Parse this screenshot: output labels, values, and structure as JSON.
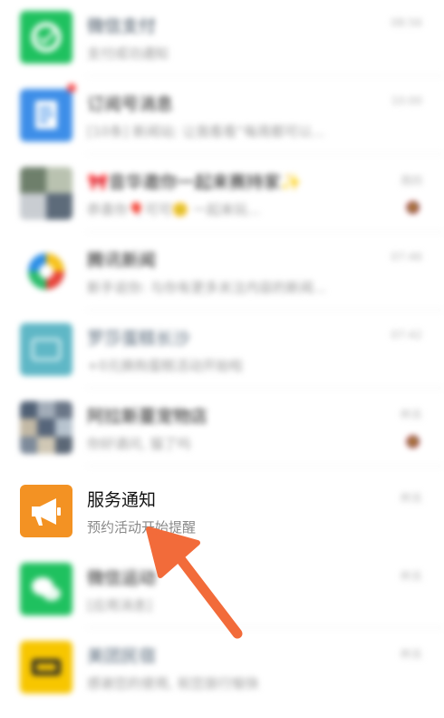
{
  "colors": {
    "wechat_green": "#1fc15f",
    "blue": "#3d8ee8",
    "orange": "#f39223",
    "yellow": "#f7c600",
    "arrow": "#f26b3a",
    "teal": "#5fb7c6"
  },
  "chat_list": {
    "items": [
      {
        "title": "微信支付",
        "preview": "支付成功通知",
        "time": "08:56",
        "icon": "wechat-pay-icon"
      },
      {
        "title": "订阅号消息",
        "preview": "[10条] 新闻站: 让我看看“每周都可以...",
        "time": "10:00",
        "icon": "document-icon"
      },
      {
        "title": "🎀音华邀你一起来赛持家✨",
        "preview": "恭喜你🎈可可🙂 一起来玩...",
        "time": "周四",
        "icon": "photo-collage-icon"
      },
      {
        "title": "腾讯新闻",
        "preview": "新手说你: 与你有更多关注内容的新闻...",
        "time": "07:46",
        "icon": "tencent-news-icon"
      },
      {
        "title": "罗莎蛋糕长沙",
        "preview": "+0元换购蛋糕活动开始啦",
        "time": "07:42",
        "icon": "cake-shop-icon"
      },
      {
        "title": "阿拉斯蔓宠物店",
        "preview": "你好请问, 猫了吗",
        "time": "昨天",
        "icon": "pet-shop-icon"
      },
      {
        "title": "服务通知",
        "preview": "预约活动开始提醒",
        "time": "昨天",
        "icon": "megaphone-icon"
      },
      {
        "title": "微信运动",
        "preview": "[应用消息]",
        "time": "昨天",
        "icon": "wechat-sport-icon"
      },
      {
        "title": "美团民宿",
        "preview": "感谢您的使用, 祝您旅行愉快",
        "time": "昨天",
        "icon": "meituan-icon"
      }
    ]
  }
}
